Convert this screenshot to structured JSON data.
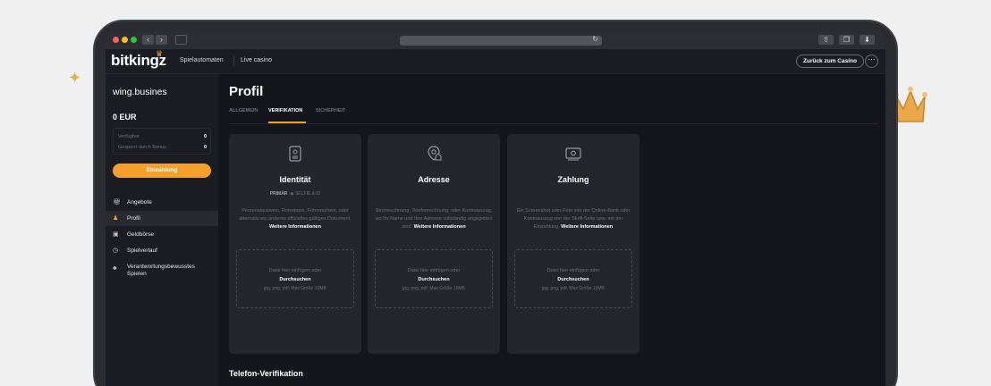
{
  "decorations": {
    "sparkle_icon": "sparkle-icon",
    "crown_icon": "crown-icon"
  },
  "chrome": {
    "colors": {
      "close": "#ff5f57",
      "minimize": "#febc2e",
      "maximize": "#28c840"
    }
  },
  "header": {
    "logo": "bitkingz",
    "nav": [
      "Spielautomaten",
      "Live casino"
    ],
    "back_button": "Zurück zum Casino",
    "more_button": "···"
  },
  "sidebar": {
    "username": "wing.busines",
    "balance": "0  EUR",
    "available_label": "Verfügbar",
    "available_value": "0",
    "locked_label": "Gesperrt durch Bonus",
    "locked_value": "0",
    "deposit_button": "Einzahlung",
    "items": [
      {
        "label": "Angebote",
        "icon": "gift-icon",
        "active": false
      },
      {
        "label": "Profil",
        "icon": "user-icon",
        "active": true
      },
      {
        "label": "Geldbörse",
        "icon": "wallet-icon",
        "active": false
      },
      {
        "label": "Spielverlauf",
        "icon": "history-icon",
        "active": false
      },
      {
        "label": "Verantwortungsbewusstes Spielen",
        "icon": "responsible-gaming-icon",
        "active": false
      }
    ]
  },
  "main": {
    "title": "Profil",
    "tabs": [
      {
        "label": "ALLGEMEIN",
        "active": false
      },
      {
        "label": "VERIFIKATION",
        "active": true
      },
      {
        "label": "SICHERHEIT",
        "active": false
      }
    ],
    "cards": [
      {
        "title": "Identität",
        "icon": "id-document-icon",
        "meta_primary": "PRIMÄR",
        "meta_secondary": "SELFIE & ID",
        "description": "Personalausweis, Reisepass, Führerschein, oder alternativ ein anderes offizielles gültiges Dokument.",
        "more_info": "Weitere Informationen"
      },
      {
        "title": "Adresse",
        "icon": "address-icon",
        "description": "Stromrechnung, Telefonrechnung, oder Kontoauszug, wo Ihr Name und Ihre Adresse vollständig angegeben sind.",
        "more_info": "Weitere Informationen"
      },
      {
        "title": "Zahlung",
        "icon": "payment-card-icon",
        "description": "Ein Screenshot oder Foto von der Online-Bank oder Kontoauszug von der Skrill-Seite usw. mit der Einzahlung.",
        "more_info": "Weitere Informationen"
      }
    ],
    "dropzone": {
      "text": "Datei hier einfügen oder",
      "browse": "Durchsuchen",
      "formats": "jpg, png, pdf. Max Größe 10MB"
    },
    "phone_section_title": "Telefon-Verifikation"
  },
  "accent_color": "#f5a02a"
}
